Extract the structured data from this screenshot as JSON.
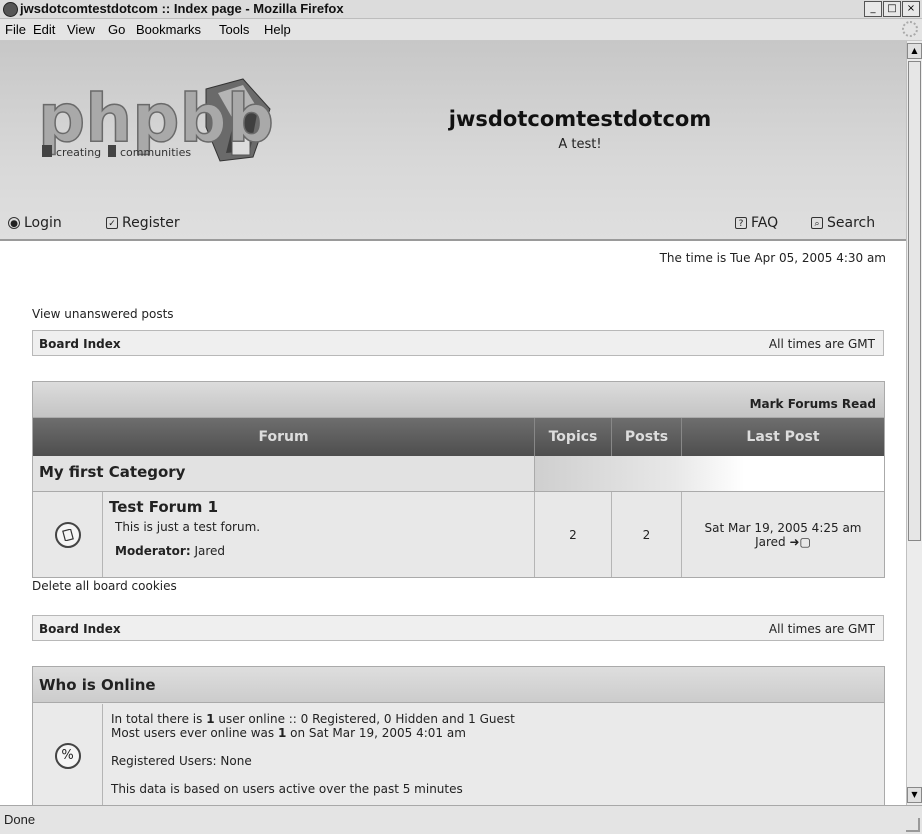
{
  "window": {
    "title": "jwsdotcomtestdotcom :: Index page - Mozilla Firefox",
    "buttons": [
      "_",
      "□",
      "×"
    ]
  },
  "menu": [
    "File",
    "Edit",
    "View",
    "Go",
    "Bookmarks",
    "Tools",
    "Help"
  ],
  "logo": {
    "text": "phpbb",
    "tagline_a": "creating",
    "tagline_b": "communities"
  },
  "site": {
    "title": "jwsdotcomtestdotcom",
    "description": "A test!"
  },
  "nav": {
    "login": "Login",
    "register": "Register",
    "faq": "FAQ",
    "search": "Search"
  },
  "time_text": "The time is Tue Apr 05, 2005 4:30 am",
  "unanswered": "View unanswered posts",
  "breadcrumb": {
    "left": "Board Index",
    "right": "All times are GMT"
  },
  "mark_read": "Mark Forums Read",
  "table_head": {
    "forum": "Forum",
    "topics": "Topics",
    "posts": "Posts",
    "last_post": "Last Post"
  },
  "category": "My first Category",
  "forum": {
    "name": "Test Forum 1",
    "description": "This is just a test forum.",
    "moderator_label": "Moderator:",
    "moderator": "Jared",
    "topics": "2",
    "posts": "2",
    "last_post_date": "Sat Mar 19, 2005 4:25 am",
    "last_post_user": "Jared"
  },
  "delete_cookies": "Delete all board cookies",
  "online": {
    "title": "Who is Online",
    "line1_a": "In total there is ",
    "line1_b": "1",
    "line1_c": " user online :: 0 Registered, 0 Hidden and 1 Guest",
    "line2_a": "Most users ever online was ",
    "line2_b": "1",
    "line2_c": " on Sat Mar 19, 2005 4:01 am",
    "registered": "Registered Users: None",
    "active_note": "This data is based on users active over the past 5 minutes"
  },
  "status": "Done"
}
